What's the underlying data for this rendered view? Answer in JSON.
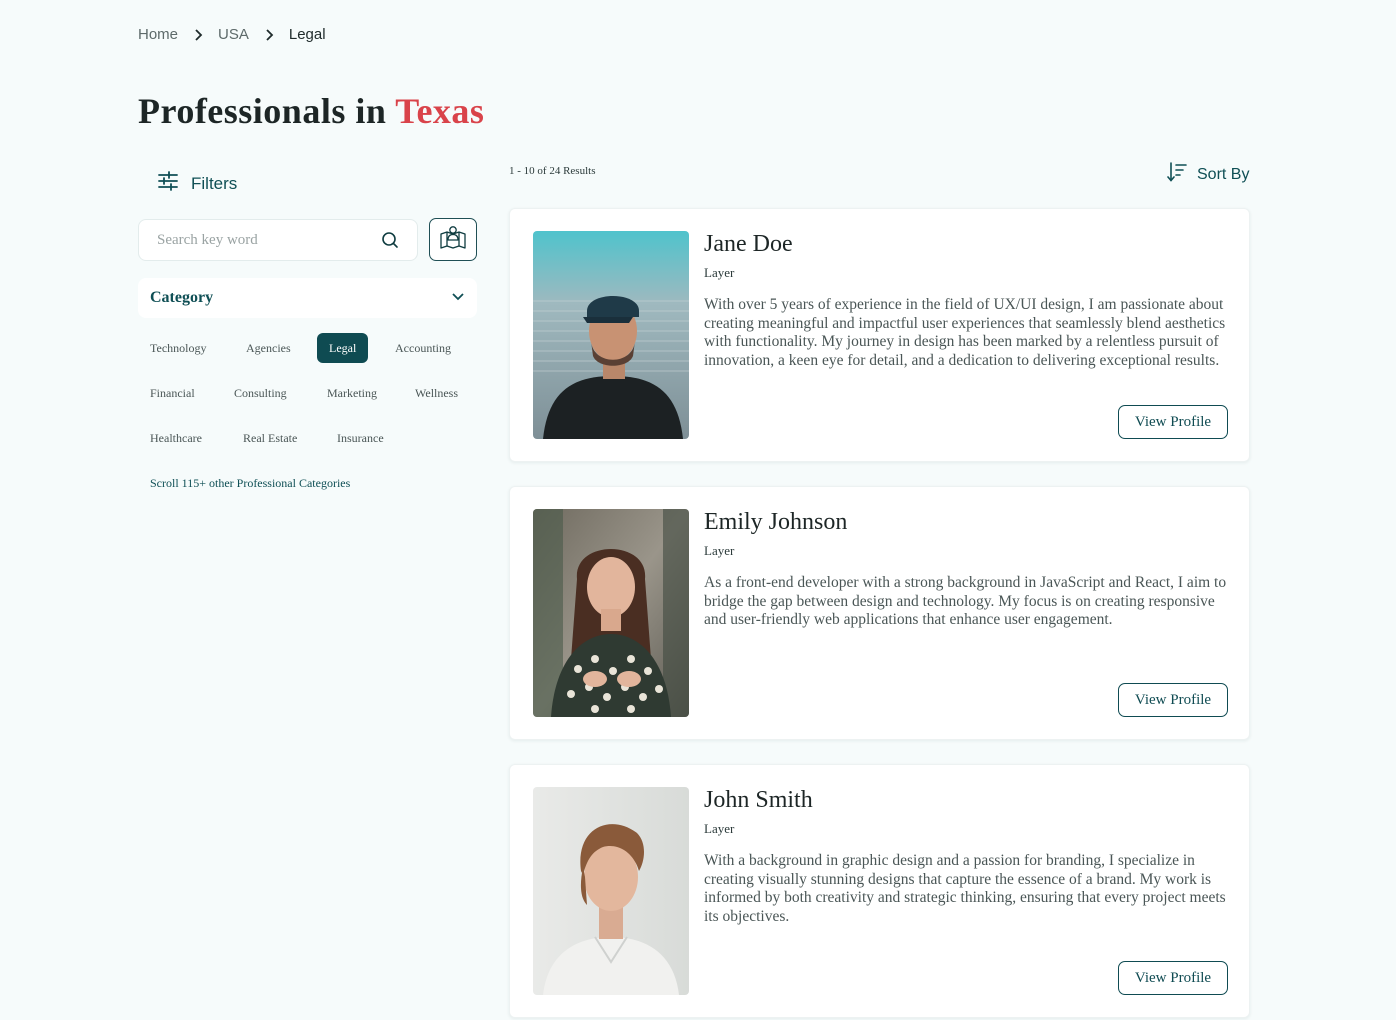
{
  "breadcrumb": {
    "items": [
      "Home",
      "USA",
      "Legal"
    ]
  },
  "title": {
    "prefix": "Professionals in",
    "location": "Texas"
  },
  "sidebar": {
    "filters_label": "Filters",
    "search_placeholder": "Search key word",
    "category_label": "Category",
    "categories": [
      "Technology",
      "Agencies",
      "Legal",
      "Accounting",
      "Financial",
      "Consulting",
      "Marketing",
      "Wellness",
      "Healthcare",
      "Real Estate",
      "Insurance"
    ],
    "active_category": "Legal",
    "more_link": "Scroll 115+ other Professional Categories"
  },
  "results": {
    "count_text": "1 - 10 of 24 Results",
    "sort_label": "Sort By",
    "profiles": [
      {
        "name": "Jane Doe",
        "role": "Layer",
        "bio": "With over 5 years of experience in the field of UX/UI design, I am passionate about creating meaningful and impactful user experiences that seamlessly blend aesthetics with functionality. My journey in design has been marked by a relentless pursuit of innovation, a keen eye for detail, and a dedication to delivering exceptional results.",
        "button": "View Profile"
      },
      {
        "name": "Emily Johnson",
        "role": "Layer",
        "bio": "As a front-end developer with a strong background in JavaScript and React, I aim to bridge the gap between design and technology. My focus is on creating responsive and user-friendly web applications that enhance user engagement.",
        "button": "View Profile"
      },
      {
        "name": "John Smith",
        "role": "Layer",
        "bio": "With a background in graphic design and a passion for branding, I specialize in creating visually stunning designs that capture the essence of a brand. My work is informed by both creativity and strategic thinking, ensuring that every project meets its objectives.",
        "button": "View Profile"
      }
    ]
  },
  "colors": {
    "accent": "#d9434a",
    "brand": "#0f4b52",
    "background": "#f6fbfb"
  }
}
